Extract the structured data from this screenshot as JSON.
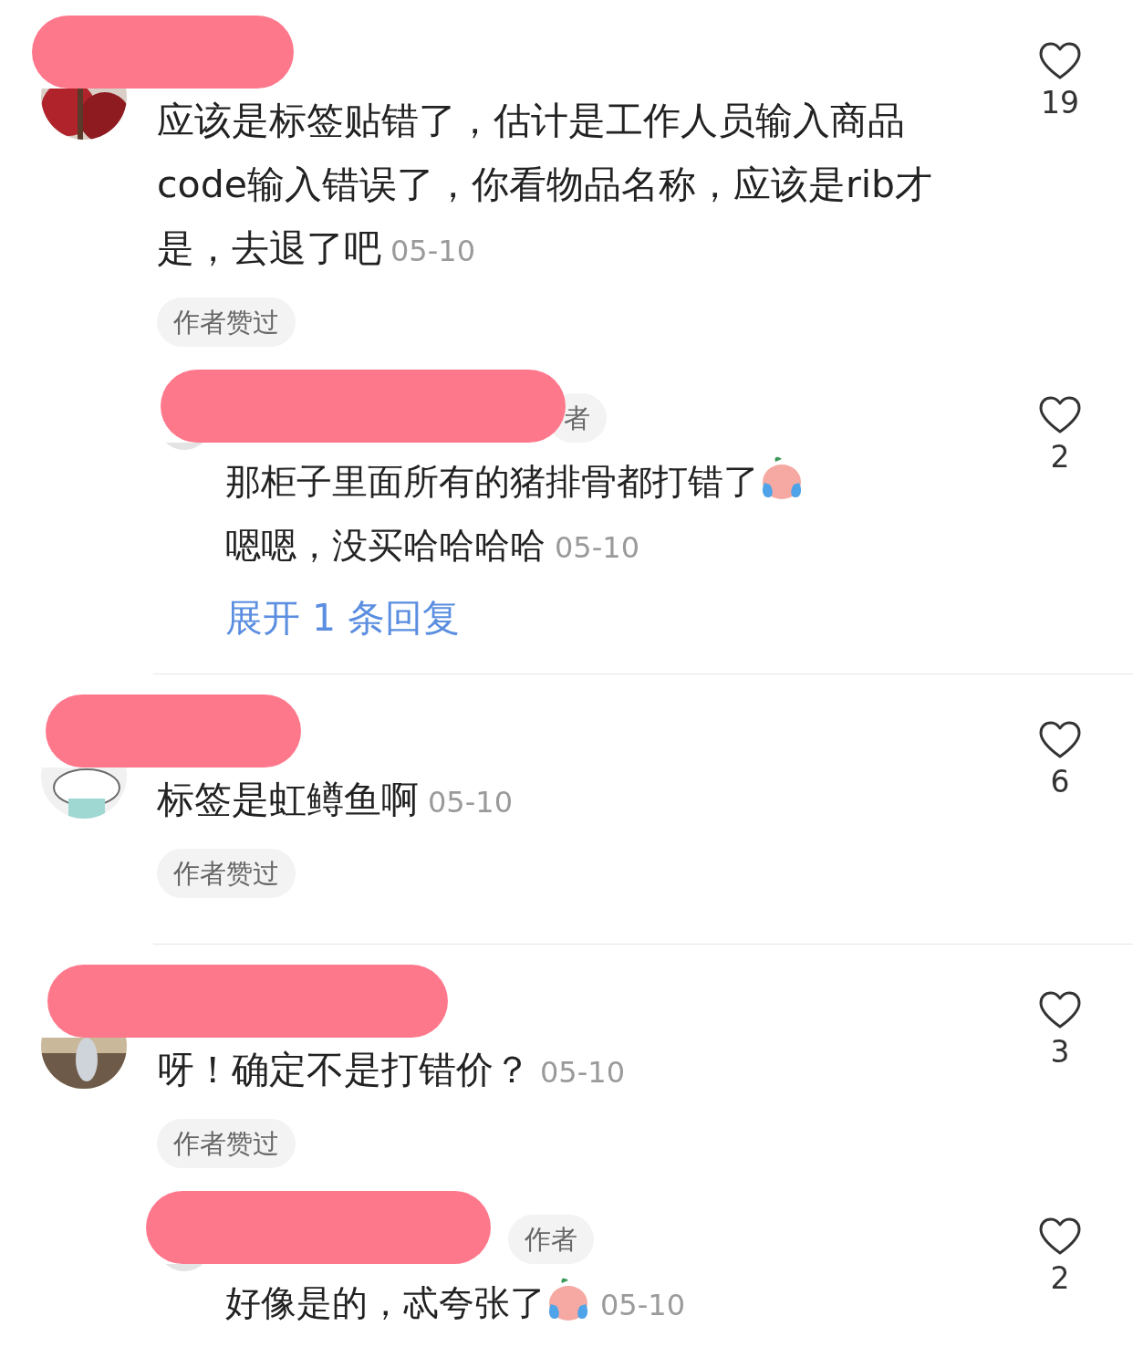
{
  "comments": [
    {
      "text": [
        {
          "kind": "text",
          "text": "应该是标签贴错了，估计是工作人员输入商品code输入错误了，你看物品名称，应该是rib才是，去退了吧"
        }
      ],
      "date": "05-10",
      "badge": "作者赞过",
      "likes": "19",
      "replies": [
        {
          "author_tag": "者",
          "text": [
            {
              "kind": "text",
              "text": "那柜子里面所有的猪排骨都打错了"
            },
            {
              "kind": "emoji"
            },
            {
              "kind": "text",
              "text": "嗯嗯，没买哈哈哈哈"
            }
          ],
          "date": "05-10",
          "likes": "2",
          "expand": "展开 1 条回复"
        }
      ]
    },
    {
      "text": [
        {
          "kind": "text",
          "text": "标签是虹鳟鱼啊"
        }
      ],
      "date": "05-10",
      "badge": "作者赞过",
      "likes": "6"
    },
    {
      "text": [
        {
          "kind": "text",
          "text": "呀！确定不是打错价？"
        }
      ],
      "date": "05-10",
      "badge": "作者赞过",
      "likes": "3",
      "replies": [
        {
          "author_tag": "作者",
          "text": [
            {
              "kind": "text",
              "text": "好像是的，忒夸张了"
            },
            {
              "kind": "emoji"
            }
          ],
          "date": "05-10",
          "likes": "2"
        }
      ]
    }
  ]
}
